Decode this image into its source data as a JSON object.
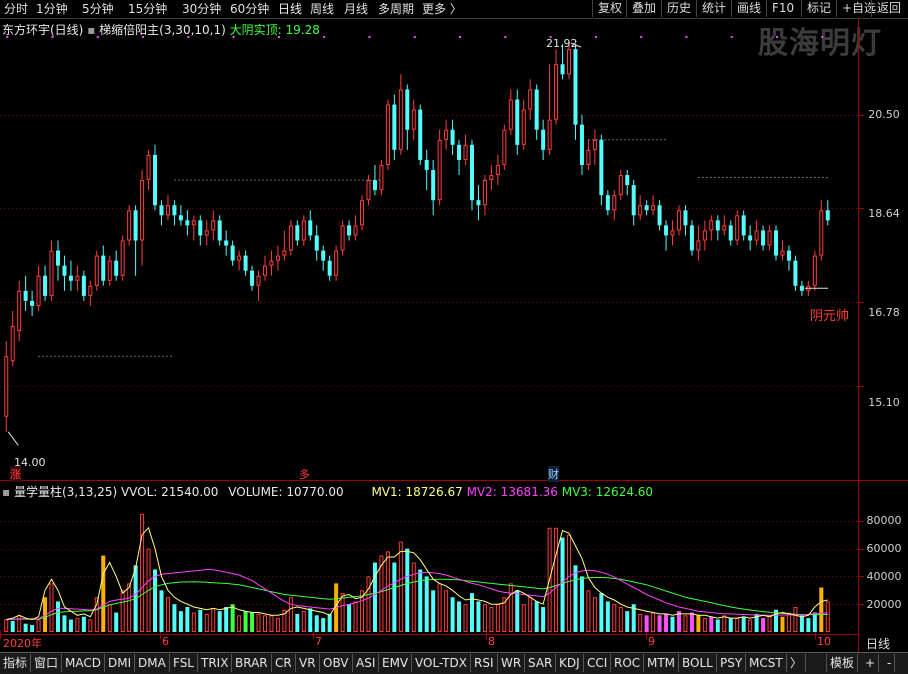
{
  "periods": [
    "分时",
    "1分钟",
    "5分钟",
    "15分钟",
    "30分钟",
    "60分钟",
    "日线",
    "周线",
    "月线",
    "多周期",
    "更多 〉"
  ],
  "tools": [
    "复权",
    "叠加",
    "历史",
    "统计",
    "画线",
    "F10",
    "标记",
    "+自选",
    "返回"
  ],
  "watermark": "股海明灯",
  "stock_title": "东方环宇(日线)",
  "indicator_title": "梯缩倍阳主(3,30,10,1)",
  "indicator_note": "大阴实顶: 19.28",
  "price_axis": [
    "20.50",
    "18.64",
    "16.78",
    "15.10"
  ],
  "price_hi_label": "21.92",
  "price_lo_label": "14.00",
  "annotation": "阴元帅",
  "markers": [
    "涨",
    "多",
    "财"
  ],
  "vol_title": "量学量柱(3,13,25)",
  "vvol": "VVOL: 21540.00",
  "volume": "VOLUME: 10770.00",
  "mv1": "MV1: 18726.67",
  "mv2": "MV2: 13681.36",
  "mv3": "MV3: 12624.60",
  "vol_axis": [
    "80000",
    "60000",
    "40000",
    "20000"
  ],
  "date_labels": [
    "2020年",
    "6",
    "7",
    "8",
    "9",
    "10"
  ],
  "period_label": "日线",
  "indicators": [
    "指标",
    "窗口",
    "MACD",
    "DMI",
    "DMA",
    "FSL",
    "TRIX",
    "BRAR",
    "CR",
    "VR",
    "OBV",
    "ASI",
    "EMV",
    "VOL-TDX",
    "RSI",
    "WR",
    "SAR",
    "KDJ",
    "CCI",
    "ROC",
    "MTM",
    "BOLL",
    "PSY",
    "MCST",
    "〉"
  ],
  "template_label": "模板",
  "zoom_in": "+",
  "zoom_out": "-",
  "colors": {
    "up": "#ff3c3c",
    "down": "#54fcfc",
    "mv1": "#ffff80",
    "mv2": "#ff40ff",
    "mv3": "#40ff40",
    "gold": "#ffb000",
    "pink": "#ff50ff",
    "green": "#40ff40"
  },
  "chart_data": {
    "type": "candlestick",
    "ylim": [
      13.6,
      22.3
    ],
    "vol_ylim": [
      0,
      95000
    ],
    "candles": [
      [
        14.5,
        15.7,
        16.0,
        14.2,
        9000
      ],
      [
        15.6,
        16.3,
        16.6,
        15.5,
        8000
      ],
      [
        16.2,
        17.0,
        17.2,
        16.0,
        12000
      ],
      [
        17.0,
        16.8,
        17.3,
        16.6,
        6000
      ],
      [
        16.8,
        16.7,
        17.0,
        16.5,
        5000
      ],
      [
        16.7,
        17.3,
        17.5,
        16.6,
        9000
      ],
      [
        17.3,
        16.9,
        17.5,
        16.8,
        25000
      ],
      [
        16.9,
        17.8,
        18.0,
        16.8,
        35000
      ],
      [
        17.8,
        17.5,
        18.0,
        17.2,
        22000
      ],
      [
        17.5,
        17.3,
        17.7,
        17.0,
        12000
      ],
      [
        17.3,
        17.2,
        17.6,
        17.0,
        9000
      ],
      [
        17.2,
        17.3,
        17.5,
        17.0,
        10000
      ],
      [
        17.3,
        16.9,
        17.4,
        16.8,
        11000
      ],
      [
        16.9,
        17.1,
        17.2,
        16.7,
        9000
      ],
      [
        17.1,
        17.7,
        17.8,
        17.0,
        25000
      ],
      [
        17.7,
        17.2,
        17.9,
        17.1,
        55000
      ],
      [
        17.2,
        17.6,
        17.7,
        17.1,
        20000
      ],
      [
        17.6,
        17.3,
        17.8,
        17.2,
        14000
      ],
      [
        17.3,
        18.0,
        18.1,
        17.2,
        30000
      ],
      [
        18.0,
        18.6,
        18.7,
        17.9,
        35000
      ],
      [
        18.6,
        18.0,
        18.7,
        17.3,
        48000
      ],
      [
        18.0,
        19.2,
        19.4,
        17.5,
        85000
      ],
      [
        19.2,
        19.7,
        19.8,
        19.0,
        60000
      ],
      [
        19.7,
        18.7,
        19.9,
        18.6,
        45000
      ],
      [
        18.7,
        18.5,
        18.8,
        18.3,
        30000
      ],
      [
        18.5,
        18.7,
        18.9,
        18.4,
        25000
      ],
      [
        18.7,
        18.5,
        18.8,
        18.3,
        20000
      ],
      [
        18.5,
        18.4,
        18.7,
        18.3,
        15000
      ],
      [
        18.4,
        18.3,
        18.6,
        18.1,
        18000
      ],
      [
        18.3,
        18.4,
        18.5,
        18.0,
        14000
      ],
      [
        18.4,
        18.1,
        18.5,
        17.9,
        16000
      ],
      [
        18.1,
        18.2,
        18.4,
        17.9,
        13000
      ],
      [
        18.2,
        18.4,
        18.6,
        18.0,
        17000
      ],
      [
        18.4,
        18.0,
        18.5,
        17.9,
        15000
      ],
      [
        18.0,
        17.9,
        18.2,
        17.7,
        18000
      ],
      [
        17.9,
        17.6,
        18.0,
        17.5,
        20000
      ],
      [
        17.6,
        17.7,
        17.8,
        17.4,
        12000
      ],
      [
        17.7,
        17.4,
        17.8,
        17.3,
        15000
      ],
      [
        17.4,
        17.1,
        17.5,
        17.0,
        14000
      ],
      [
        17.1,
        17.3,
        17.4,
        16.8,
        13000
      ],
      [
        17.3,
        17.5,
        17.7,
        17.2,
        12000
      ],
      [
        17.5,
        17.6,
        17.8,
        17.3,
        12000
      ],
      [
        17.6,
        17.7,
        17.9,
        17.4,
        10000
      ],
      [
        17.7,
        17.8,
        18.2,
        17.6,
        16000
      ],
      [
        17.8,
        18.3,
        18.4,
        17.7,
        25000
      ],
      [
        18.3,
        18.0,
        18.4,
        17.9,
        13000
      ],
      [
        18.0,
        18.4,
        18.5,
        17.9,
        15000
      ],
      [
        18.4,
        18.1,
        18.6,
        18.0,
        17000
      ],
      [
        18.1,
        17.8,
        18.3,
        17.6,
        12000
      ],
      [
        17.8,
        17.6,
        17.9,
        17.4,
        10000
      ],
      [
        17.6,
        17.3,
        17.7,
        17.2,
        13000
      ],
      [
        17.3,
        17.8,
        17.9,
        17.2,
        35000
      ],
      [
        17.8,
        18.3,
        18.4,
        17.7,
        28000
      ],
      [
        18.3,
        18.1,
        18.4,
        18.0,
        20000
      ],
      [
        18.1,
        18.3,
        18.5,
        18.0,
        22000
      ],
      [
        18.3,
        18.8,
        18.9,
        18.2,
        30000
      ],
      [
        18.8,
        19.2,
        19.3,
        18.7,
        40000
      ],
      [
        19.2,
        19.0,
        19.5,
        18.9,
        50000
      ],
      [
        19.0,
        19.5,
        19.6,
        18.9,
        55000
      ],
      [
        19.5,
        20.7,
        20.8,
        19.4,
        58000
      ],
      [
        20.7,
        19.8,
        20.9,
        19.6,
        50000
      ],
      [
        19.8,
        21.0,
        21.3,
        19.7,
        65000
      ],
      [
        21.0,
        20.2,
        21.1,
        19.8,
        60000
      ],
      [
        20.2,
        20.6,
        20.8,
        20.0,
        50000
      ],
      [
        20.6,
        19.6,
        20.7,
        19.5,
        45000
      ],
      [
        19.6,
        19.4,
        19.8,
        19.0,
        40000
      ],
      [
        19.4,
        18.8,
        19.6,
        18.5,
        30000
      ],
      [
        18.8,
        20.0,
        20.2,
        18.7,
        35000
      ],
      [
        20.0,
        20.2,
        20.4,
        19.8,
        30000
      ],
      [
        20.2,
        19.9,
        20.4,
        19.7,
        25000
      ],
      [
        19.9,
        19.6,
        20.0,
        19.3,
        22000
      ],
      [
        19.6,
        19.9,
        20.1,
        19.5,
        20000
      ],
      [
        19.9,
        18.8,
        20.0,
        18.6,
        28000
      ],
      [
        18.8,
        18.7,
        19.1,
        18.4,
        22000
      ],
      [
        18.7,
        19.2,
        19.3,
        18.5,
        20000
      ],
      [
        19.2,
        19.3,
        19.5,
        19.0,
        18000
      ],
      [
        19.3,
        19.5,
        19.7,
        19.1,
        20000
      ],
      [
        19.5,
        20.2,
        20.3,
        19.4,
        25000
      ],
      [
        20.2,
        20.8,
        21.0,
        20.1,
        35000
      ],
      [
        20.8,
        19.9,
        21.0,
        19.7,
        30000
      ],
      [
        19.9,
        20.6,
        20.8,
        19.8,
        20000
      ],
      [
        20.6,
        21.0,
        21.2,
        20.4,
        25000
      ],
      [
        21.0,
        20.2,
        21.1,
        20.0,
        22000
      ],
      [
        20.2,
        19.8,
        20.4,
        19.6,
        18000
      ],
      [
        19.8,
        20.4,
        21.5,
        19.7,
        75000
      ],
      [
        20.4,
        21.5,
        21.8,
        20.3,
        75000
      ],
      [
        21.5,
        21.3,
        21.9,
        21.2,
        68000
      ],
      [
        21.3,
        21.8,
        21.92,
        21.2,
        70000
      ],
      [
        21.8,
        20.3,
        21.9,
        20.0,
        48000
      ],
      [
        20.3,
        19.5,
        20.5,
        19.3,
        40000
      ],
      [
        19.5,
        19.8,
        20.0,
        19.4,
        30000
      ],
      [
        19.8,
        20.0,
        20.2,
        19.5,
        25000
      ],
      [
        20.0,
        18.9,
        20.1,
        18.7,
        28000
      ],
      [
        18.9,
        18.6,
        19.0,
        18.5,
        22000
      ],
      [
        18.6,
        18.9,
        19.0,
        18.4,
        20000
      ],
      [
        18.9,
        19.3,
        19.4,
        18.8,
        18000
      ],
      [
        19.3,
        19.1,
        19.4,
        18.9,
        15000
      ],
      [
        19.1,
        18.5,
        19.2,
        18.3,
        20000
      ],
      [
        18.5,
        18.7,
        18.9,
        18.4,
        13000
      ],
      [
        18.7,
        18.6,
        18.8,
        18.5,
        12000
      ],
      [
        18.6,
        18.7,
        18.9,
        18.5,
        14000
      ],
      [
        18.7,
        18.3,
        18.8,
        18.2,
        12000
      ],
      [
        18.3,
        18.1,
        18.4,
        17.8,
        13000
      ],
      [
        18.1,
        18.2,
        18.4,
        17.9,
        11000
      ],
      [
        18.2,
        18.6,
        18.7,
        18.1,
        15000
      ],
      [
        18.6,
        18.3,
        18.7,
        18.1,
        12000
      ],
      [
        18.3,
        17.8,
        18.4,
        17.7,
        14000
      ],
      [
        17.8,
        18.0,
        18.3,
        17.6,
        12000
      ],
      [
        18.0,
        18.2,
        18.4,
        17.8,
        10000
      ],
      [
        18.2,
        18.4,
        18.5,
        18.0,
        11000
      ],
      [
        18.4,
        18.2,
        18.5,
        18.0,
        9000
      ],
      [
        18.2,
        18.3,
        18.5,
        18.1,
        12000
      ],
      [
        18.3,
        18.0,
        18.4,
        17.9,
        10000
      ],
      [
        18.0,
        18.5,
        18.6,
        17.9,
        10000
      ],
      [
        18.5,
        18.1,
        18.6,
        18.0,
        11000
      ],
      [
        18.1,
        18.0,
        18.3,
        17.8,
        9000
      ],
      [
        18.0,
        18.2,
        18.4,
        17.9,
        13000
      ],
      [
        18.2,
        17.9,
        18.3,
        17.8,
        10000
      ],
      [
        17.9,
        18.2,
        18.3,
        17.8,
        12000
      ],
      [
        18.2,
        17.7,
        18.3,
        17.6,
        16000
      ],
      [
        17.7,
        17.8,
        18.0,
        17.6,
        11000
      ],
      [
        17.8,
        17.6,
        17.9,
        17.4,
        14000
      ],
      [
        17.6,
        17.1,
        17.7,
        17.0,
        18000
      ],
      [
        17.1,
        17.0,
        17.2,
        16.9,
        12000
      ],
      [
        17.0,
        17.1,
        17.2,
        16.9,
        10000
      ],
      [
        17.1,
        17.7,
        17.8,
        17.0,
        14000
      ],
      [
        17.7,
        18.6,
        18.8,
        17.6,
        32000
      ],
      [
        18.6,
        18.4,
        18.8,
        18.3,
        22000
      ]
    ],
    "vol_color": [
      "up",
      "down",
      "up",
      "down",
      "down",
      "up",
      "gold",
      "up",
      "down",
      "down",
      "down",
      "up",
      "down",
      "up",
      "up",
      "gold",
      "up",
      "down",
      "up",
      "up",
      "down",
      "up",
      "up",
      "down",
      "down",
      "up",
      "down",
      "down",
      "down",
      "up",
      "down",
      "up",
      "up",
      "down",
      "down",
      "green",
      "up",
      "green",
      "green",
      "up",
      "up",
      "up",
      "up",
      "up",
      "up",
      "down",
      "up",
      "down",
      "down",
      "down",
      "down",
      "gold",
      "up",
      "down",
      "up",
      "up",
      "up",
      "down",
      "up",
      "up",
      "down",
      "up",
      "down",
      "up",
      "down",
      "down",
      "down",
      "up",
      "up",
      "down",
      "down",
      "up",
      "down",
      "down",
      "up",
      "up",
      "up",
      "up",
      "up",
      "down",
      "up",
      "up",
      "down",
      "down",
      "up",
      "up",
      "down",
      "up",
      "down",
      "down",
      "up",
      "up",
      "down",
      "down",
      "up",
      "up",
      "down",
      "down",
      "up",
      "pink",
      "up",
      "pink",
      "pink",
      "down",
      "pink",
      "up",
      "pink",
      "gold",
      "up",
      "pink",
      "down",
      "up",
      "down",
      "up",
      "down",
      "up",
      "down",
      "pink",
      "up",
      "down",
      "gold",
      "up",
      "up",
      "down",
      "down",
      "down",
      "gold",
      "up",
      "up",
      "gold"
    ],
    "mv1": [
      9000,
      10000,
      12000,
      10000,
      9000,
      11000,
      30000,
      38000,
      30000,
      18000,
      15000,
      12000,
      13000,
      11000,
      20000,
      42000,
      50000,
      40000,
      28000,
      32000,
      46000,
      70000,
      75000,
      60000,
      40000,
      30000,
      25000,
      22000,
      20000,
      18000,
      17000,
      16000,
      17000,
      16000,
      17000,
      18000,
      16000,
      15000,
      14000,
      14000,
      13000,
      12000,
      12000,
      13000,
      17000,
      18000,
      17000,
      16000,
      15000,
      14000,
      12000,
      19000,
      26000,
      27000,
      24000,
      25000,
      31000,
      40000,
      48000,
      54000,
      54000,
      58000,
      58000,
      57000,
      52000,
      45000,
      38000,
      35000,
      33000,
      30000,
      26000,
      23000,
      24000,
      23000,
      22000,
      20000,
      20000,
      21000,
      27000,
      30000,
      28000,
      25000,
      22000,
      20000,
      38000,
      56000,
      73000,
      71000,
      62000,
      53000,
      39000,
      32000,
      28000,
      25000,
      23000,
      20000,
      18000,
      17000,
      16000,
      15000,
      14000,
      13000,
      13000,
      12000,
      13000,
      13000,
      13000,
      12000,
      12000,
      11000,
      10000,
      11000,
      10000,
      10000,
      11000,
      10000,
      11000,
      12000,
      11000,
      13000,
      14000,
      13000,
      12000,
      11000,
      12000,
      18000,
      22000,
      23000
    ],
    "mv2": [
      9000,
      9200,
      9600,
      9600,
      9400,
      9500,
      12000,
      15000,
      17000,
      17000,
      16800,
      16500,
      16200,
      15800,
      16500,
      19500,
      22000,
      23000,
      23500,
      24500,
      27000,
      32000,
      37000,
      40000,
      41500,
      42000,
      42500,
      43000,
      43500,
      44000,
      44500,
      45000,
      44800,
      44000,
      43000,
      42000,
      41000,
      39000,
      37000,
      34000,
      31000,
      28000,
      25000,
      22000,
      20000,
      19000,
      18500,
      18000,
      17500,
      17000,
      16500,
      17500,
      19000,
      20000,
      21000,
      22500,
      24500,
      27000,
      30000,
      33000,
      35500,
      38000,
      40000,
      41500,
      42500,
      43000,
      42500,
      42000,
      41000,
      39500,
      38000,
      36500,
      35000,
      34000,
      32500,
      31000,
      29500,
      28500,
      28000,
      27500,
      27000,
      26500,
      26000,
      25500,
      28000,
      32000,
      36000,
      40000,
      42500,
      44000,
      44500,
      44000,
      43000,
      41500,
      39500,
      37000,
      34500,
      32000,
      29500,
      27000,
      25000,
      23000,
      21000,
      19500,
      18000,
      17000,
      16000,
      15000,
      14500,
      14000,
      13500,
      13200,
      13000,
      12800,
      12600,
      12400,
      12200,
      12100,
      12000,
      12100,
      12200,
      12300,
      12400,
      12500,
      12700,
      13300,
      13600,
      13700
    ],
    "mv3": [
      9000,
      9100,
      9300,
      9300,
      9200,
      9300,
      10500,
      12500,
      14000,
      14500,
      14800,
      15000,
      15200,
      15300,
      16000,
      18000,
      19500,
      20500,
      21500,
      22500,
      24000,
      27000,
      30000,
      32500,
      34000,
      35000,
      35500,
      36000,
      36000,
      36200,
      36000,
      35800,
      35500,
      35200,
      35000,
      34500,
      34000,
      33000,
      32000,
      31000,
      30000,
      29000,
      28000,
      27000,
      26500,
      26000,
      25500,
      25000,
      24500,
      24000,
      23500,
      24000,
      24500,
      25000,
      25500,
      26000,
      27000,
      28000,
      29000,
      30500,
      32000,
      33500,
      35000,
      36000,
      37000,
      37500,
      37800,
      38000,
      38000,
      37800,
      37500,
      37000,
      36500,
      36000,
      35500,
      35000,
      34500,
      34000,
      33500,
      33000,
      32500,
      32000,
      31500,
      31000,
      32000,
      33500,
      35000,
      36500,
      37500,
      38500,
      39000,
      39200,
      39200,
      39000,
      38500,
      38000,
      37000,
      36000,
      35000,
      34000,
      32500,
      31000,
      29500,
      28000,
      26500,
      25000,
      24000,
      23000,
      22000,
      21000,
      20000,
      19000,
      18000,
      17200,
      16500,
      15800,
      15200,
      14700,
      14200,
      13800,
      13400,
      13100,
      12800,
      12600,
      12500,
      12550,
      12600,
      12624
    ]
  }
}
